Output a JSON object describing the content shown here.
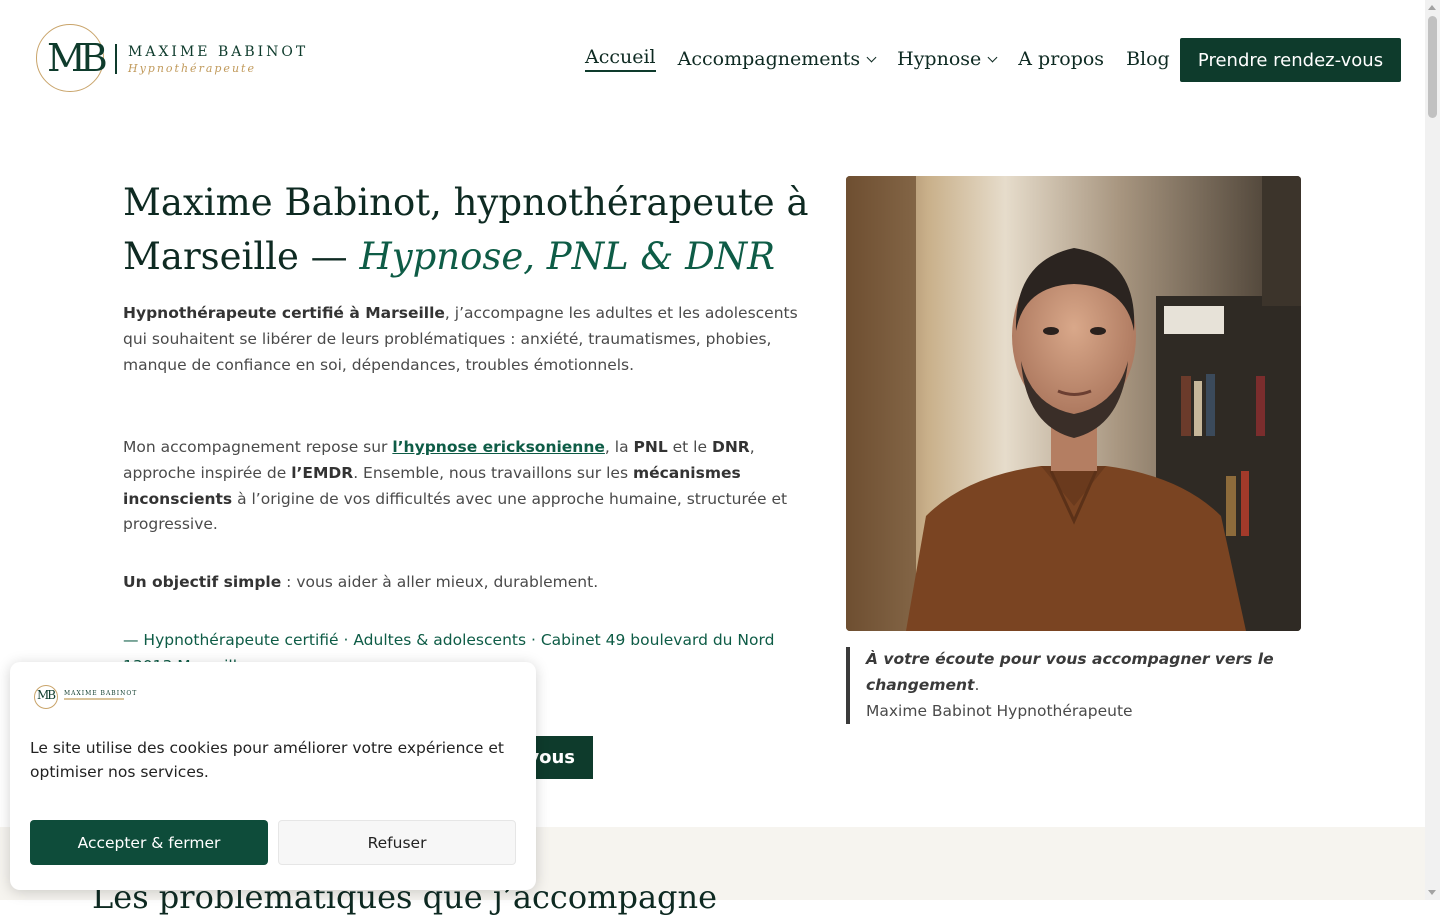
{
  "header": {
    "logo": {
      "initials": "MB",
      "name": "MAXIME BABINOT",
      "subtitle": "Hypnothérapeute"
    },
    "nav": [
      {
        "label": "Accueil",
        "active": true
      },
      {
        "label": "Accompagnements",
        "dropdown": true
      },
      {
        "label": "Hypnose",
        "dropdown": true
      },
      {
        "label": "A propos"
      },
      {
        "label": "Blog"
      }
    ],
    "cta_label": "Prendre rendez-vous"
  },
  "hero": {
    "title_main": "Maxime Babinot, hypnothérapeute à Marseille — ",
    "title_em": "Hypnose, PNL & DNR",
    "p1": {
      "strong": "Hypnothérapeute certifié à Marseille",
      "text": ", j’accompagne les adultes et les adolescents qui souhaitent se libérer de leurs problématiques : anxiété, traumatismes, phobies, manque de confiance en soi, dépendances, troubles émotionnels."
    },
    "p2": {
      "t1": "Mon accompagnement repose sur ",
      "link": "l’hypnose ericksonienne",
      "t2": ", la ",
      "b1": "PNL",
      "t3": " et le ",
      "b2": "DNR",
      "t4": ", approche inspirée de ",
      "b3": "l’EMDR",
      "t5": ". Ensemble, nous travaillons sur les ",
      "b4": "mécanismes inconscients",
      "t6": " à l’origine de vos difficultés avec une approche humaine, structurée et progressive."
    },
    "p3": {
      "strong": "Un objectif simple",
      "text": " : vous aider à aller mieux, durablement."
    },
    "tagline": "— Hypnothérapeute certifié · Adultes & adolescents · Cabinet 49 boulevard du Nord 13013 Marseille",
    "button_label": "vous"
  },
  "quote": {
    "emphasis": "À votre écoute pour vous accompagner vers le changement",
    "period": ".",
    "author": "Maxime Babinot Hypnothérapeute"
  },
  "section_title": "Les problématiques que j’accompagne",
  "cookie": {
    "logo_initials": "MB",
    "logo_name": "MAXIME BABINOT",
    "text": "Le site utilise des cookies pour améliorer votre expérience et optimiser nos services.",
    "accept_label": "Accepter & fermer",
    "refuse_label": "Refuser"
  },
  "colors": {
    "brand_green": "#0e3b2c",
    "accent_gold": "#c9a46a",
    "link_green": "#0e5c46"
  }
}
